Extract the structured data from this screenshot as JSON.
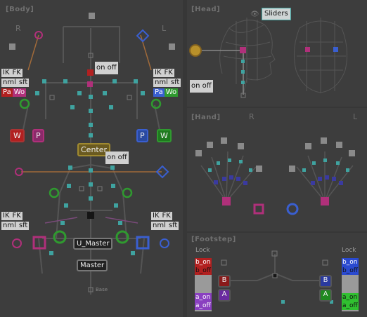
{
  "body": {
    "title": "[Body]",
    "right": "R",
    "left": "L",
    "ik_fk_r": [
      "IK",
      "FK"
    ],
    "nml_sft_r": [
      "nml",
      "sft"
    ],
    "pa_r": "Pa",
    "wo_r": "Wo",
    "ik_fk_l": [
      "IK",
      "FK"
    ],
    "nml_sft_l": [
      "nml",
      "sft"
    ],
    "pa_l": "Pa",
    "wo_l": "Wo",
    "onoff_head": "on off",
    "w_r": "W",
    "p_r": "P",
    "p_l": "P",
    "w_l": "W",
    "center": "Center",
    "onoff_center": "on off",
    "leg_ik_fk_r": [
      "IK",
      "FK"
    ],
    "leg_nml_sft_r": [
      "nml",
      "sft"
    ],
    "leg_ik_fk_l": [
      "IK",
      "FK"
    ],
    "leg_nml_sft_l": [
      "nml",
      "sft"
    ],
    "u_master": "U_Master",
    "master": "Master",
    "base": "Base"
  },
  "head": {
    "title": "[Head]",
    "sliders": "Sliders",
    "onoff": "on off"
  },
  "hand": {
    "title": "[Hand]",
    "right": "R",
    "left": "L"
  },
  "footstep": {
    "title": "[Footstep]",
    "lock_r": "Lock",
    "lock_l": "Lock",
    "b_on": "b_on",
    "b_off": "b_off",
    "a_on": "a_on",
    "a_off": "a_off",
    "B": "B",
    "A": "A",
    "Bl": "B",
    "Al": "A"
  },
  "colors": {
    "teal": "#3fa3a0",
    "magenta": "#b0307a",
    "blue": "#3a5fd0",
    "green": "#2f9a2f",
    "red": "#b22020"
  }
}
